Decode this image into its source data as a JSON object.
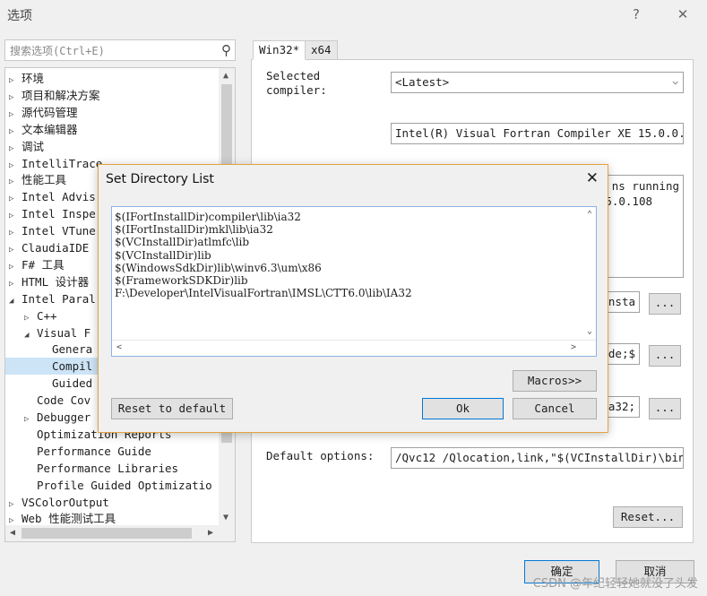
{
  "window": {
    "title": "选项",
    "help_label": "?",
    "close_label": "✕"
  },
  "search": {
    "placeholder": "搜索选项(Ctrl+E)",
    "icon": "search-icon"
  },
  "tree": {
    "items": [
      {
        "label": "环境",
        "arrow": "▷"
      },
      {
        "label": "项目和解决方案",
        "arrow": "▷"
      },
      {
        "label": "源代码管理",
        "arrow": "▷"
      },
      {
        "label": "文本编辑器",
        "arrow": "▷"
      },
      {
        "label": "调试",
        "arrow": "▷"
      },
      {
        "label": "IntelliTrace",
        "arrow": "▷"
      },
      {
        "label": "性能工具",
        "arrow": "▷"
      },
      {
        "label": "Intel Advis",
        "arrow": "▷"
      },
      {
        "label": "Intel Inspe",
        "arrow": "▷"
      },
      {
        "label": "Intel VTune",
        "arrow": "▷"
      },
      {
        "label": "ClaudiaIDE",
        "arrow": "▷"
      },
      {
        "label": "F# 工具",
        "arrow": "▷"
      },
      {
        "label": "HTML 设计器",
        "arrow": "▷"
      },
      {
        "label": "Intel Paral",
        "arrow": "◢"
      },
      {
        "label": "C++",
        "arrow": "▷"
      },
      {
        "label": "Visual F",
        "arrow": "◢"
      },
      {
        "label": "Genera",
        "arrow": ""
      },
      {
        "label": "Compil",
        "arrow": ""
      },
      {
        "label": "Guided",
        "arrow": ""
      },
      {
        "label": "Code Cov",
        "arrow": ""
      },
      {
        "label": "Debugger",
        "arrow": "▷"
      },
      {
        "label": "Optimization Reports",
        "arrow": ""
      },
      {
        "label": "Performance Guide",
        "arrow": ""
      },
      {
        "label": "Performance Libraries",
        "arrow": ""
      },
      {
        "label": "Profile Guided Optimizatio",
        "arrow": ""
      },
      {
        "label": "VSColorOutput",
        "arrow": "▷"
      },
      {
        "label": "Web 性能测试工具",
        "arrow": "▷"
      }
    ]
  },
  "tabs": [
    {
      "label": "Win32*"
    },
    {
      "label": "x64"
    }
  ],
  "settings": {
    "selected_compiler_label": "Selected compiler:",
    "selected_compiler_value": "<Latest>",
    "compiler_name": "Intel(R) Visual Fortran Compiler XE 15.0.0.",
    "info_line1": "ns running",
    "info_line2": "5.0.108",
    "field_a": "nsta",
    "field_b": "de;$",
    "field_c": "a32;",
    "ellipsis": "...",
    "default_options_label": "Default options:",
    "default_options_value": "/Qvc12 /Qlocation,link,\"$(VCInstallDir)\\bin",
    "reset_label": "Reset..."
  },
  "dialog": {
    "title": "Set Directory List",
    "close_label": "✕",
    "dirs": [
      "$(IFortInstallDir)compiler\\lib\\ia32",
      "$(IFortInstallDir)mkl\\lib\\ia32",
      "$(VCInstallDir)atlmfc\\lib",
      "$(VCInstallDir)lib",
      "$(WindowsSdkDir)lib\\winv6.3\\um\\x86",
      "$(FrameworkSDKDir)lib",
      "F:\\Developer\\IntelVisualFortran\\IMSL\\CTT6.0\\lib\\IA32"
    ],
    "macros_label": "Macros>>",
    "reset_default_label": "Reset to default",
    "ok_label": "Ok",
    "cancel_label": "Cancel"
  },
  "footer": {
    "ok_label": "确定",
    "cancel_label": "取消"
  },
  "watermark": "CSDN @年纪轻轻她就没了头发"
}
